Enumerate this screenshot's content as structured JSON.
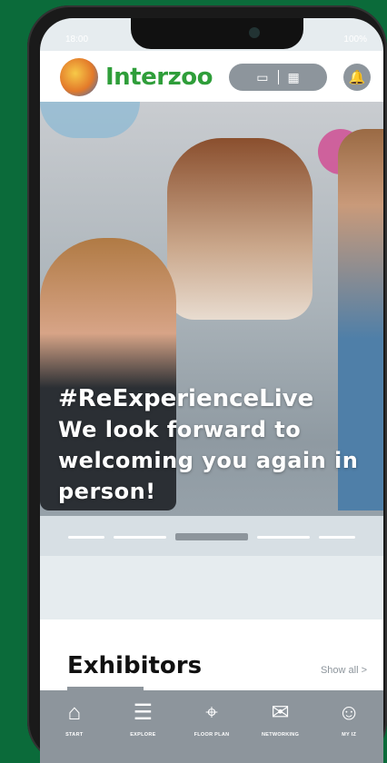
{
  "status_bar": {
    "time": "18:00",
    "right": "100%"
  },
  "header": {
    "brand": "Interzoo",
    "ticket_icon": "ticket-icon",
    "qr_icon": "qr-icon",
    "bell_icon": "bell-icon"
  },
  "hero": {
    "tag": "#ReExperienceLive",
    "message": "We look forward to welcoming you again in person!",
    "carousel_pages": 5,
    "active_page": 3
  },
  "section": {
    "title": "Exhibitors",
    "show_all": "Show all >"
  },
  "tabs": [
    {
      "label": "START",
      "icon": "home-icon"
    },
    {
      "label": "EXPLORE",
      "icon": "list-search-icon"
    },
    {
      "label": "FLOOR PLAN",
      "icon": "map-pin-icon"
    },
    {
      "label": "NETWORKING",
      "icon": "handshake-icon"
    },
    {
      "label": "MY IZ",
      "icon": "user-list-icon"
    }
  ],
  "colors": {
    "brand_green": "#2f9e3a",
    "accent_gray": "#8d959c",
    "background": "#0b6b3a"
  }
}
